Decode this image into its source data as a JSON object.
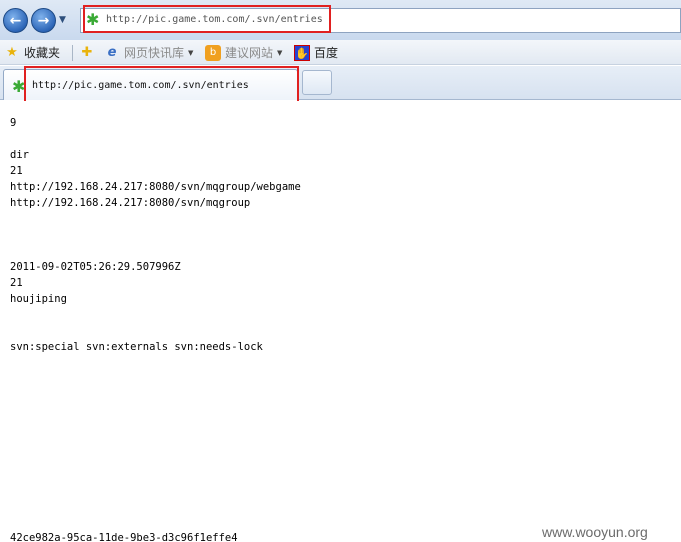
{
  "navigation": {
    "back_glyph": "←",
    "forward_glyph": "→",
    "dropdown_glyph": "▼",
    "address_url": "http://pic.game.tom.com/.svn/entries"
  },
  "favorites_bar": {
    "favorites_label": "收藏夹",
    "webslice_label": "网页快讯库",
    "suggested_sites_label": "建议网站",
    "baidu_label": "百度"
  },
  "tab": {
    "title": "http://pic.game.tom.com/.svn/entries"
  },
  "content": {
    "lines": [
      "9",
      "dir",
      "21",
      "http://192.168.24.217:8080/svn/mqgroup/webgame",
      "http://192.168.24.217:8080/svn/mqgroup",
      "2011-09-02T05:26:29.507996Z",
      "21",
      "houjiping",
      "svn:special svn:externals svn:needs-lock",
      "42ce982a-95ca-11de-9be3-d3c96f1effe4"
    ]
  },
  "watermark": "www.wooyun.org",
  "colors": {
    "highlight_red": "#e02020",
    "clover_green": "#3aaa35"
  }
}
